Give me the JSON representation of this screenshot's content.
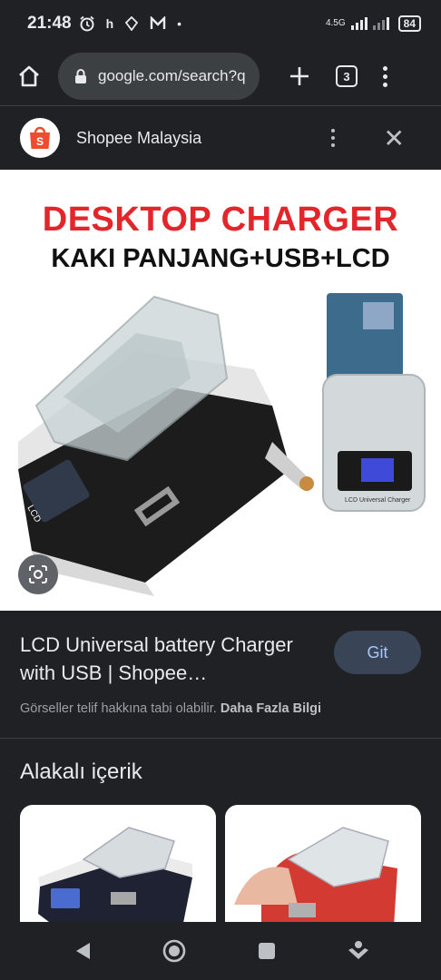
{
  "status_bar": {
    "time": "21:48",
    "icons": [
      "alarm-icon",
      "h",
      "location-icon",
      "m-icon",
      "dot"
    ],
    "h_label": "h",
    "net_label": "4.5G",
    "battery": "84"
  },
  "browser": {
    "url": "google.com/search?q",
    "tab_count": "3"
  },
  "source": {
    "name": "Shopee Malaysia",
    "logo_letter": "S",
    "brand_color": "#ee4d2d"
  },
  "hero_image": {
    "headline": "DESKTOP CHARGER",
    "subheadline": "KAKI PANJANG+USB+LCD",
    "lcd_label": "LCD",
    "lcd_label_right": "LCD Universal Charger"
  },
  "result": {
    "title": "LCD Universal battery Charger with USB | Shopee…",
    "visit_label": "Git",
    "copyright_text": "Görseller telif hakkına tabi olabilir.",
    "more_info_label": "Daha Fazla Bilgi"
  },
  "related": {
    "title": "Alakalı içerik"
  },
  "colors": {
    "background": "#202124",
    "accent": "#a8c7fa",
    "button_bg": "#394457",
    "headline_red": "#e3262b"
  }
}
